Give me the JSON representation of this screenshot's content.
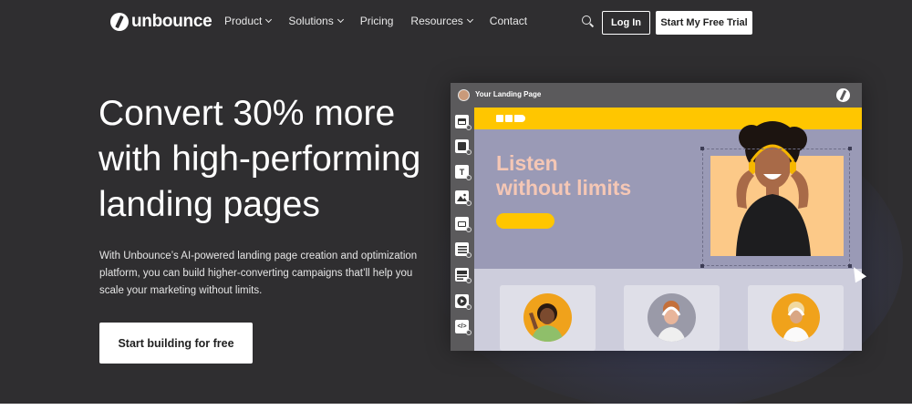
{
  "nav": {
    "brand": "unbounce",
    "menu": [
      {
        "label": "Product",
        "dropdown": true
      },
      {
        "label": "Solutions",
        "dropdown": true
      },
      {
        "label": "Pricing",
        "dropdown": false
      },
      {
        "label": "Resources",
        "dropdown": true
      },
      {
        "label": "Contact",
        "dropdown": false
      }
    ],
    "login_label": "Log In",
    "trial_label": "Start My Free Trial",
    "search_icon": "search-icon"
  },
  "hero": {
    "headline_lines": [
      "Convert 30% more",
      "with high-performing",
      "landing pages"
    ],
    "subtext_lines": [
      "With Unbounce’s AI-powered landing page creation and optimization",
      "platform, you can build higher-converting campaigns that’ll help you",
      "scale your marketing without limits."
    ],
    "cta_label": "Start building for free"
  },
  "mockup": {
    "window_title": "Your Landing Page",
    "headline_lines": [
      "Listen",
      "without limits"
    ],
    "tools": [
      "section-icon",
      "box-icon",
      "text-icon",
      "image-icon",
      "button-icon",
      "form-icon",
      "list-icon",
      "video-icon",
      "code-icon"
    ],
    "tool_text_glyph": "T",
    "tool_code_glyph": "</>"
  },
  "colors": {
    "hero_bg": "#2f2e30",
    "accent_yellow": "#ffc600",
    "mock_purple": "#9a9ab6",
    "listen_pink": "#f5c7b5"
  }
}
